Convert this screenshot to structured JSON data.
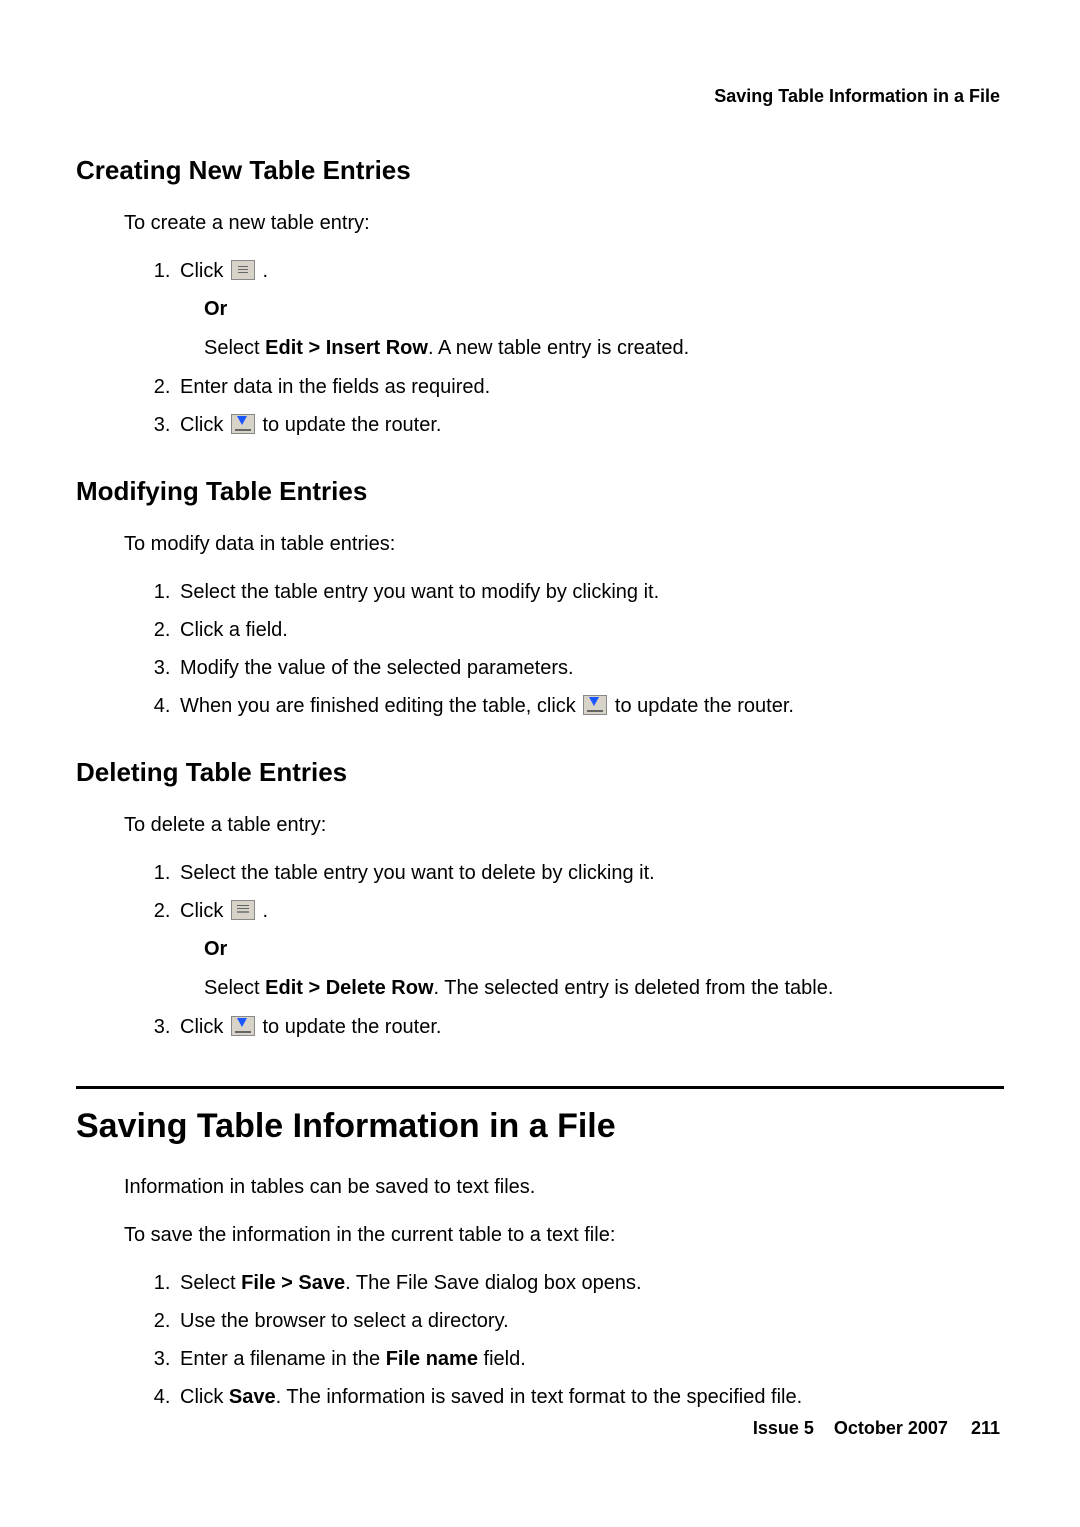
{
  "running_head": "Saving Table Information in a File",
  "section1": {
    "heading": "Creating New Table Entries",
    "intro": "To create a new table entry:",
    "step1_a": "Click ",
    "step1_b": ".",
    "or": "Or",
    "step1_alt_a": "Select ",
    "step1_alt_bold": "Edit > Insert Row",
    "step1_alt_b": ". A new table entry is created.",
    "step2": "Enter data in the fields as required.",
    "step3_a": "Click ",
    "step3_b": " to update the router."
  },
  "section2": {
    "heading": "Modifying Table Entries",
    "intro": "To modify data in table entries:",
    "step1": "Select the table entry you want to modify by clicking it.",
    "step2": "Click a field.",
    "step3": "Modify the value of the selected parameters.",
    "step4_a": "When you are finished editing the table, click ",
    "step4_b": " to update the router."
  },
  "section3": {
    "heading": "Deleting Table Entries",
    "intro": "To delete a table entry:",
    "step1": "Select the table entry you want to delete by clicking it.",
    "step2_a": "Click ",
    "step2_b": " .",
    "or": "Or",
    "step2_alt_a": "Select ",
    "step2_alt_bold": "Edit > Delete Row",
    "step2_alt_b": ". The selected entry is deleted from the table.",
    "step3_a": "Click ",
    "step3_b": " to update the router."
  },
  "section4": {
    "heading": "Saving Table Information in a File",
    "intro1": "Information in tables can be saved to text files.",
    "intro2": "To save the information in the current table to a text file:",
    "step1_a": "Select ",
    "step1_bold": "File > Save",
    "step1_b": ". The File Save dialog box opens.",
    "step2": "Use the browser to select a directory.",
    "step3_a": "Enter a filename in the ",
    "step3_bold": "File name",
    "step3_b": " field.",
    "step4_a": "Click ",
    "step4_bold": "Save",
    "step4_b": ". The information is saved in text format to the specified file."
  },
  "footer": {
    "issue": "Issue 5",
    "date": "October 2007",
    "page": "211"
  }
}
